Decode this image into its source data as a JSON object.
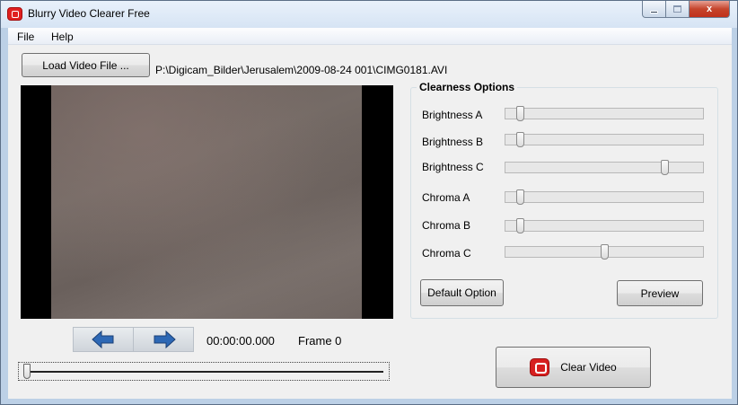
{
  "window": {
    "title": "Blurry Video Clearer Free",
    "buttons": {
      "minimize": "minimize",
      "maximize": "maximize",
      "close": "x"
    }
  },
  "menu": {
    "items": [
      "File",
      "Help"
    ]
  },
  "toolbar": {
    "load_button": "Load Video File ...",
    "file_path": "P:\\Digicam_Bilder\\Jerusalem\\2009-08-24 001\\CIMG0181.AVI"
  },
  "clearness": {
    "title": "Clearness Options",
    "sliders": [
      {
        "label": "Brightness A",
        "value": 0.05
      },
      {
        "label": "Brightness B",
        "value": 0.05
      },
      {
        "label": "Brightness C",
        "value": 0.82
      },
      {
        "label": "Chroma A",
        "value": 0.05
      },
      {
        "label": "Chroma B",
        "value": 0.05
      },
      {
        "label": "Chroma C",
        "value": 0.5
      }
    ],
    "default_button": "Default Option",
    "preview_button": "Preview"
  },
  "playback": {
    "time": "00:00:00.000",
    "frame": "Frame 0",
    "position": 0.0,
    "prev_icon": "arrow-left-icon",
    "next_icon": "arrow-right-icon"
  },
  "actions": {
    "clear_button": "Clear Video"
  },
  "colors": {
    "accent_red": "#d71f1f",
    "arrow_blue": "#2d68b5"
  }
}
